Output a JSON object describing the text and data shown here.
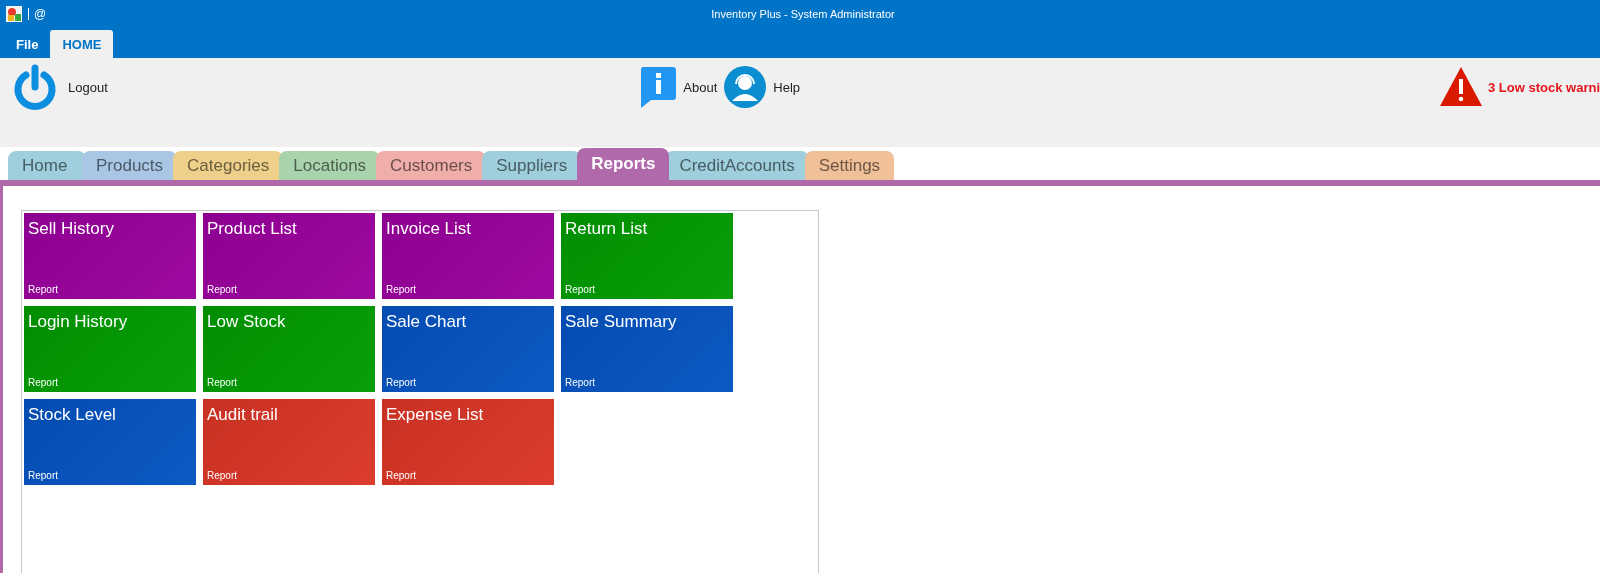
{
  "window": {
    "title": "Inventory Plus - System Administrator",
    "quick_access": "@"
  },
  "ribbon_tabs": [
    {
      "label": "File",
      "selected": false
    },
    {
      "label": "HOME",
      "selected": true
    }
  ],
  "ribbon": {
    "logout": "Logout",
    "about": "About",
    "help": "Help",
    "warning": "3 Low stock warni"
  },
  "tabs": [
    {
      "label": "Home",
      "selected": false,
      "color": "#9fcfdc"
    },
    {
      "label": "Products",
      "selected": false,
      "color": "#a9c7e4"
    },
    {
      "label": "Categories",
      "selected": false,
      "color": "#efd08a"
    },
    {
      "label": "Locations",
      "selected": false,
      "color": "#a9d3ad"
    },
    {
      "label": "Customers",
      "selected": false,
      "color": "#f0aeab"
    },
    {
      "label": "Suppliers",
      "selected": false,
      "color": "#9fcfdc"
    },
    {
      "label": "Reports",
      "selected": true,
      "color": "#b06aab"
    },
    {
      "label": "CreditAccounts",
      "selected": false,
      "color": "#9fcfdc"
    },
    {
      "label": "Settings",
      "selected": false,
      "color": "#f0c099"
    }
  ],
  "tiles": [
    {
      "title": "Sell History",
      "subtitle": "Report",
      "color": "#99009c"
    },
    {
      "title": "Product List",
      "subtitle": "Report",
      "color": "#99009c"
    },
    {
      "title": "Invoice List",
      "subtitle": "Report",
      "color": "#99009c"
    },
    {
      "title": "Return List",
      "subtitle": "Report",
      "color": "#009a00"
    },
    {
      "title": "Login History",
      "subtitle": "Report",
      "color": "#009a00"
    },
    {
      "title": "Low Stock",
      "subtitle": "Report",
      "color": "#009a00"
    },
    {
      "title": "Sale Chart",
      "subtitle": "Report",
      "color": "#0452c0"
    },
    {
      "title": "Sale Summary",
      "subtitle": "Report",
      "color": "#0452c0"
    },
    {
      "title": "Stock Level",
      "subtitle": "Report",
      "color": "#0452c0"
    },
    {
      "title": "Audit trail",
      "subtitle": "Report",
      "color": "#d93526"
    },
    {
      "title": "Expense List",
      "subtitle": "Report",
      "color": "#d93526"
    }
  ]
}
